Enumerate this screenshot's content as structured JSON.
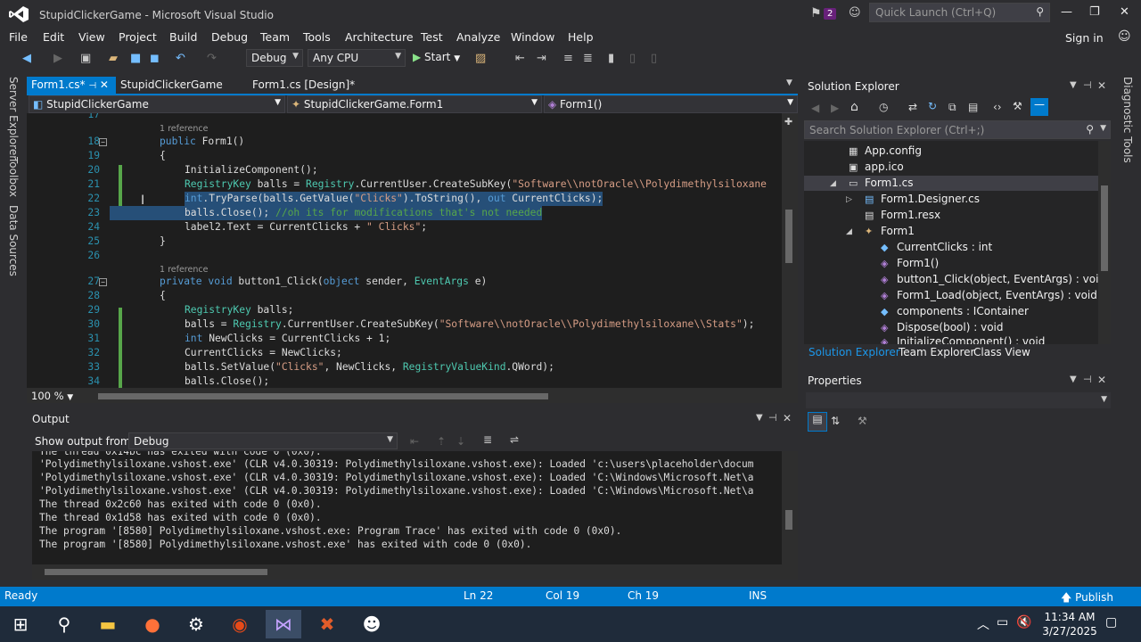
{
  "window": {
    "title": "StupidClickerGame - Microsoft Visual Studio",
    "notification_count": "2",
    "quick_launch_placeholder": "Quick Launch (Ctrl+Q)"
  },
  "menu": {
    "items": [
      "File",
      "Edit",
      "View",
      "Project",
      "Build",
      "Debug",
      "Team",
      "Tools",
      "Architecture",
      "Test",
      "Analyze",
      "Window",
      "Help"
    ],
    "signin": "Sign in"
  },
  "toolbar": {
    "config": "Debug",
    "platform": "Any CPU",
    "start": "Start"
  },
  "left_tools": [
    "Server Explorer",
    "Toolbox",
    "Data Sources"
  ],
  "right_tools": [
    "Diagnostic Tools"
  ],
  "editor_tabs": [
    {
      "label": "Form1.cs*",
      "active": true
    },
    {
      "label": "StupidClickerGame",
      "active": false
    },
    {
      "label": "Form1.cs [Design]*",
      "active": false
    }
  ],
  "navbar": {
    "project": "StupidClickerGame",
    "class": "StupidClickerGame.Form1",
    "member": "Form1()"
  },
  "code": {
    "line17": "17",
    "ref1": "1 reference",
    "l18": {
      "n": "18",
      "kw": "public",
      "rest": " Form1()"
    },
    "l19": {
      "n": "19",
      "text": "{"
    },
    "l20": {
      "n": "20",
      "text": "InitializeComponent();"
    },
    "l21": {
      "n": "21",
      "ty": "RegistryKey",
      "a": " balls = ",
      "ty2": "Registry",
      "b": ".CurrentUser.CreateSubKey(",
      "st": "\"Software\\\\notOracle\\\\Polydimethylsiloxane"
    },
    "l22": {
      "n": "22",
      "kw": "int",
      "a": ".TryParse(balls.GetValue(",
      "st": "\"Clicks\"",
      "b": ").ToString(), ",
      "kw2": "out",
      "c": " CurrentClicks);"
    },
    "l23": {
      "n": "23",
      "a": "balls.Close(); ",
      "cm": "//oh its for modifications that's not needed"
    },
    "l24": {
      "n": "24",
      "a": "label2.Text = CurrentClicks + ",
      "st": "\" Clicks\"",
      "b": ";"
    },
    "l25": {
      "n": "25",
      "text": "}"
    },
    "l26": {
      "n": "26",
      "text": ""
    },
    "ref2": "1 reference",
    "l27": {
      "n": "27",
      "kw": "private",
      "kw2": " void",
      "a": " button1_Click(",
      "kw3": "object",
      "b": " sender, ",
      "ty": "EventArgs",
      "c": " e)"
    },
    "l28": {
      "n": "28",
      "text": "{"
    },
    "l29": {
      "n": "29",
      "ty": "RegistryKey",
      "a": " balls;"
    },
    "l30": {
      "n": "30",
      "a": "balls = ",
      "ty": "Registry",
      "b": ".CurrentUser.CreateSubKey(",
      "st": "\"Software\\\\notOracle\\\\Polydimethylsiloxane\\\\Stats\"",
      "c": ");"
    },
    "l31": {
      "n": "31",
      "kw": "int",
      "a": " NewClicks = CurrentClicks + 1;"
    },
    "l32": {
      "n": "32",
      "a": "CurrentClicks = NewClicks;"
    },
    "l33": {
      "n": "33",
      "a": "balls.SetValue(",
      "st": "\"Clicks\"",
      "b": ", NewClicks, ",
      "ty": "RegistryValueKind",
      "c": ".QWord);"
    },
    "l34": {
      "n": "34",
      "a": "balls.Close();"
    }
  },
  "zoom": "100 %",
  "output": {
    "title": "Output",
    "show_from_label": "Show output from:",
    "source": "Debug",
    "lines": [
      "The thread 0x14bc has exited with code 0 (0x0).",
      "'Polydimethylsiloxane.vshost.exe' (CLR v4.0.30319: Polydimethylsiloxane.vshost.exe): Loaded 'c:\\users\\placeholder\\docum",
      "'Polydimethylsiloxane.vshost.exe' (CLR v4.0.30319: Polydimethylsiloxane.vshost.exe): Loaded 'C:\\Windows\\Microsoft.Net\\a",
      "'Polydimethylsiloxane.vshost.exe' (CLR v4.0.30319: Polydimethylsiloxane.vshost.exe): Loaded 'C:\\Windows\\Microsoft.Net\\a",
      "The thread 0x2c60 has exited with code 0 (0x0).",
      "The thread 0x1d58 has exited with code 0 (0x0).",
      "The program '[8580] Polydimethylsiloxane.vshost.exe: Program Trace' has exited with code 0 (0x0).",
      "The program '[8580] Polydimethylsiloxane.vshost.exe' has exited with code 0 (0x0)."
    ]
  },
  "solution_explorer": {
    "title": "Solution Explorer",
    "search_placeholder": "Search Solution Explorer (Ctrl+;)",
    "items": [
      {
        "label": "App.config",
        "icon": "config-icon"
      },
      {
        "label": "app.ico",
        "icon": "ico-file-icon"
      },
      {
        "label": "Form1.cs",
        "icon": "form-icon"
      },
      {
        "label": "Form1.Designer.cs",
        "icon": "csharp-file-icon"
      },
      {
        "label": "Form1.resx",
        "icon": "resx-file-icon"
      },
      {
        "label": "Form1",
        "icon": "class-icon"
      },
      {
        "label": "CurrentClicks : int",
        "icon": "field-icon"
      },
      {
        "label": "Form1()",
        "icon": "method-icon"
      },
      {
        "label": "button1_Click(object, EventArgs) : void",
        "icon": "method-icon"
      },
      {
        "label": "Form1_Load(object, EventArgs) : void",
        "icon": "method-icon"
      },
      {
        "label": "components : IContainer",
        "icon": "field-icon"
      },
      {
        "label": "Dispose(bool) : void",
        "icon": "method-icon"
      },
      {
        "label": "InitializeComponent() : void",
        "icon": "method-icon"
      }
    ],
    "tabs": [
      "Solution Explorer",
      "Team Explorer",
      "Class View"
    ]
  },
  "properties": {
    "title": "Properties"
  },
  "status": {
    "ready": "Ready",
    "ln": "Ln 22",
    "col": "Col 19",
    "ch": "Ch 19",
    "mode": "INS",
    "publish": "Publish"
  },
  "taskbar": {
    "time": "11:34 AM",
    "date": "3/27/2025"
  },
  "colors": {
    "accent": "#007acc",
    "editor_bg": "#1e1e1e",
    "keyword": "#569cd6",
    "type": "#4ec9b0",
    "string": "#d69d85",
    "comment": "#57a64a"
  }
}
